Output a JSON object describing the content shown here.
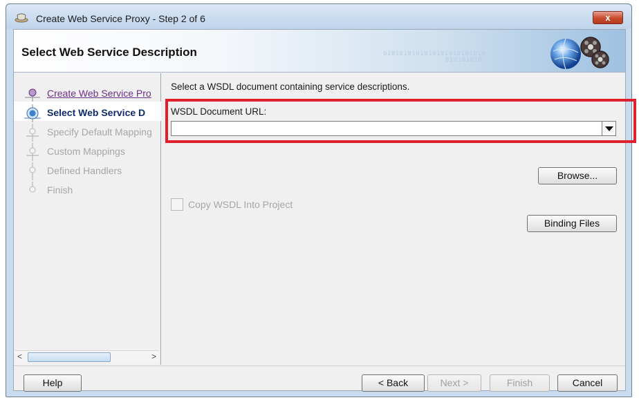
{
  "window": {
    "title": "Create Web Service Proxy - Step 2 of 6",
    "close_label": "x"
  },
  "banner": {
    "title": "Select Web Service Description",
    "binary_line1": "0101010101010101010101010",
    "binary_line2": "010101010"
  },
  "steps": [
    {
      "label": "Create Web Service Pro",
      "state": "done"
    },
    {
      "label": "Select Web Service D",
      "state": "current"
    },
    {
      "label": "Specify Default Mapping",
      "state": "pending"
    },
    {
      "label": "Custom Mappings",
      "state": "pending"
    },
    {
      "label": "Defined Handlers",
      "state": "pending"
    },
    {
      "label": "Finish",
      "state": "pending"
    }
  ],
  "main": {
    "intro": "Select a WSDL document containing service descriptions.",
    "url_label": "WSDL Document URL:",
    "url_value": "",
    "browse_label": "Browse...",
    "copy_wsdl_label": "Copy WSDL Into Project",
    "copy_wsdl_checked": false,
    "binding_files_label": "Binding Files"
  },
  "footer": {
    "help_label": "Help",
    "back_label": "< Back",
    "next_label": "Next >",
    "finish_label": "Finish",
    "cancel_label": "Cancel"
  },
  "colors": {
    "highlight": "#e0202a",
    "current_step_text": "#0f2a6b",
    "done_step_text": "#6b2f87",
    "disabled_text": "#a6a6a6"
  }
}
